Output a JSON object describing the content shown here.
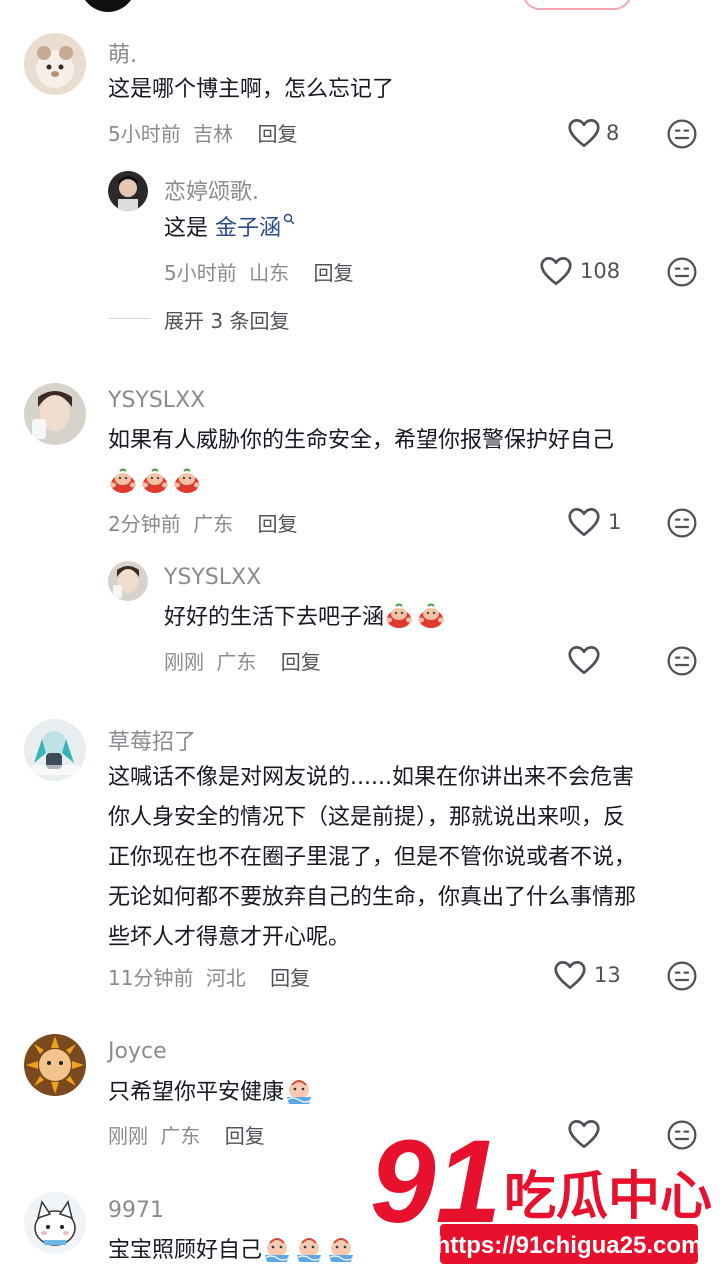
{
  "comments": [
    {
      "username": "萌.",
      "text": "这是哪个博主啊，怎么忘记了",
      "time": "5小时前",
      "location": "吉林",
      "reply_label": "回复",
      "likes": "8",
      "replies": [
        {
          "username": "恋婷颂歌.",
          "text_prefix": "这是 ",
          "mention": "金子涵",
          "mention_icon": "search-icon",
          "time": "5小时前",
          "location": "山东",
          "reply_label": "回复",
          "likes": "108"
        }
      ],
      "expand_label": "展开 3 条回复"
    },
    {
      "username": "YSYSLXX",
      "text": "如果有人威胁你的生命安全，希望你报警保护好自己",
      "emoji_count": 3,
      "emoji_icon": "hug-emoji",
      "time": "2分钟前",
      "location": "广东",
      "reply_label": "回复",
      "likes": "1",
      "replies": [
        {
          "username": "YSYSLXX",
          "text": "好好的生活下去吧子涵",
          "emoji_count": 2,
          "emoji_icon": "hug-emoji",
          "time": "刚刚",
          "location": "广东",
          "reply_label": "回复",
          "likes": ""
        }
      ]
    },
    {
      "username": "草莓招了",
      "lines": [
        "这喊话不像是对网友说的......如果在你讲出来不会危害",
        "你人身安全的情况下（这是前提），那就说出来呗，反",
        "正你现在也不在圈子里混了，但是不管你说或者不说，",
        "无论如何都不要放弃自己的生命，你真出了什么事情那",
        "些坏人才得意才开心呢。"
      ],
      "time": "11分钟前",
      "location": "河北",
      "reply_label": "回复",
      "likes": "13"
    },
    {
      "username": "Joyce",
      "text": "只希望你平安健康",
      "emoji_count": 1,
      "emoji_icon": "pray-emoji",
      "time": "刚刚",
      "location": "广东",
      "reply_label": "回复",
      "likes": ""
    },
    {
      "username": "9971",
      "text": "宝宝照顾好自己",
      "emoji_count": 3,
      "emoji_icon": "pray-emoji",
      "likes": ""
    }
  ],
  "watermark": {
    "number": "91",
    "name": "吃瓜中心",
    "url": "https://91chigua25.com"
  },
  "colors": {
    "primary_text": "#161823",
    "secondary_text": "#8a8b91",
    "mention": "#2b4a8a",
    "watermark_red": "#e8112d"
  }
}
